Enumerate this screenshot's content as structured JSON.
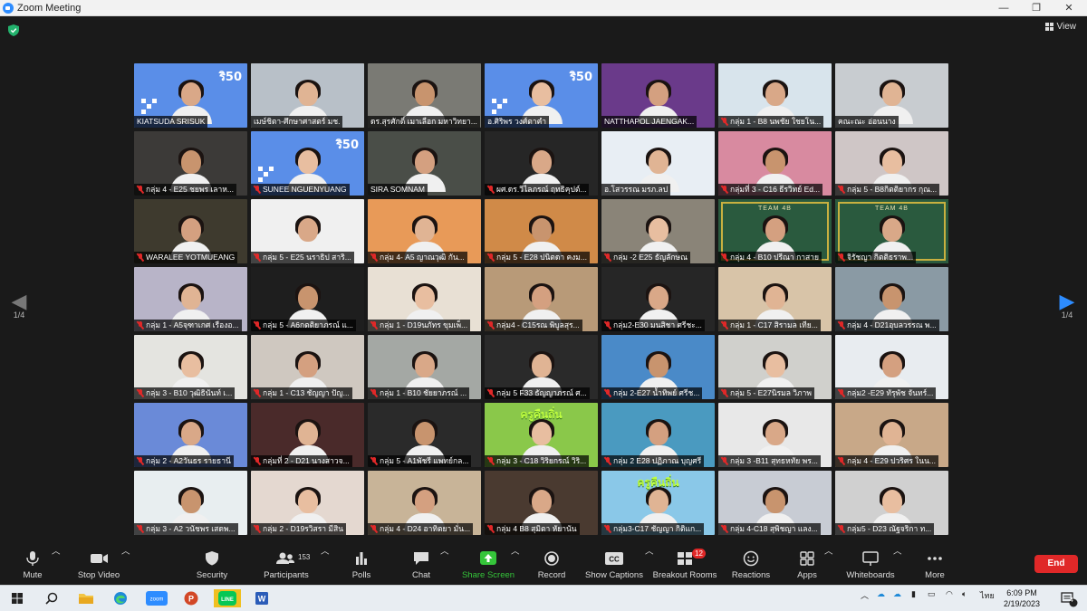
{
  "window": {
    "title": "Zoom Meeting",
    "minimize": "—",
    "maximize": "❐",
    "close": "✕"
  },
  "view_button": "View",
  "pager": {
    "left": "1/4",
    "right": "1/4"
  },
  "participants": [
    {
      "name": "KIATSUDA SRISUK",
      "muted": false,
      "bg": "#5a8ee8",
      "brand": "ริ50"
    },
    {
      "name": "เมษ์ชิตา-ศึกษาศาสตร์ มช.",
      "muted": false,
      "bg": "#b8c0c8",
      "active": true
    },
    {
      "name": "ดร.สุรศักดิ์ เมาเลือก มหาวิทยา...",
      "muted": false,
      "bg": "#7a7a74"
    },
    {
      "name": "อ.ศิริพร วงศ์ตาคำ",
      "muted": false,
      "bg": "#5a8ee8",
      "brand": "ริ50"
    },
    {
      "name": "NATTHAPOL JAENGAK...",
      "muted": false,
      "bg": "#6a3a8a"
    },
    {
      "name": "กลุ่ม 1 - B8 นพชัย ใชยโน...",
      "muted": true,
      "bg": "#d8e4ec"
    },
    {
      "name": "คณะณะ อ่อนนาง",
      "muted": false,
      "bg": "#c8ccd0"
    },
    {
      "name": "กลุ่ม 4 - E25 ชยพร เลาห...",
      "muted": true,
      "bg": "#3c3a38"
    },
    {
      "name": "SUNEE NGUENYUANG",
      "muted": true,
      "bg": "#5a8ee8",
      "brand": "ริ50"
    },
    {
      "name": "SIRA SOMNAM",
      "muted": false,
      "bg": "#4a4e48"
    },
    {
      "name": "ผศ.ดร.วิไลภรณ์ ฤทธิคุปต์...",
      "muted": true,
      "bg": "#262626"
    },
    {
      "name": "อ.โสวรรณ มรภ.ลป",
      "muted": false,
      "bg": "#e8eef4"
    },
    {
      "name": "กลุ่มที่ 3 - C16 ธีรวิทย์ Ed...",
      "muted": true,
      "bg": "#d88aa0"
    },
    {
      "name": "กลุ่ม 5 - B8กิตติยากร กุณ...",
      "muted": true,
      "bg": "#cfc6c6"
    },
    {
      "name": "WARALEE YOTMUEANG",
      "muted": true,
      "bg": "#3e3a2e"
    },
    {
      "name": "กลุ่ม 5 - E25 นราธิป สาริ...",
      "muted": true,
      "bg": "#f0f0f0"
    },
    {
      "name": "กลุ่ม 4- A5 ญาณวุฒิ กัน...",
      "muted": true,
      "bg": "#e89a58"
    },
    {
      "name": "กลุ่ม 5 - E28 ปนิตดา คงม...",
      "muted": true,
      "bg": "#d08a48"
    },
    {
      "name": "กลุ่ม -2 E25 ธัญลักษณ",
      "muted": true,
      "bg": "#8a8478"
    },
    {
      "name": "กลุ่ม 4 - B10 ปรีณา กาสาย",
      "muted": true,
      "bg": "#2a5a3e",
      "board": "TEAM 4B",
      "active": true
    },
    {
      "name": "จิรัชญา กิตติธราพ...",
      "muted": true,
      "bg": "#2a5a3e",
      "board": "TEAM 4B",
      "active": true
    },
    {
      "name": "กลุ่ม 1 - A5จุฑาเกศ เรืองอ...",
      "muted": true,
      "bg": "#b8b4c8"
    },
    {
      "name": "กลุ่ม 5 - A6กตติยาภรณ์ แ...",
      "muted": true,
      "bg": "#1e1e1e"
    },
    {
      "name": "กลุ่ม 1 - D19นภัทร ขุมเพ็...",
      "muted": true,
      "bg": "#e8e0d4"
    },
    {
      "name": "กลุ่ม4 - C15รณ พิบูลสุร...",
      "muted": true,
      "bg": "#b89a78"
    },
    {
      "name": "กลุ่ม2-E30 มนสิชา ศรีชะ...",
      "muted": true,
      "bg": "#262626"
    },
    {
      "name": "กลุ่ม 1 - C17 สิรามล เทีย...",
      "muted": true,
      "bg": "#d8c4a8"
    },
    {
      "name": "กลุ่ม 4 - D21อุบลวรรณ พ...",
      "muted": true,
      "bg": "#8a9aa4"
    },
    {
      "name": "กลุ่ม 3 - B10 วุฒิธินันท์ เ...",
      "muted": true,
      "bg": "#e4e4e0"
    },
    {
      "name": "กลุ่ม 1 - C13 ชัญญา ปัญ...",
      "muted": true,
      "bg": "#cfc8c0"
    },
    {
      "name": "กลุ่ม 1 - B10 ชัยยาภรณ์ ...",
      "muted": true,
      "bg": "#a4a8a4"
    },
    {
      "name": "กลุ่ม 5 F33 ธัญญาภรณ์ ศ...",
      "muted": true,
      "bg": "#2a2a2a"
    },
    {
      "name": "กลุ่ม 2-E27 น้ำทิพย์ ศรีช...",
      "muted": true,
      "bg": "#4a8ac8"
    },
    {
      "name": "กลุ่ม 5 - E27นิรมล วิภาพ",
      "muted": true,
      "bg": "#d0d0cc"
    },
    {
      "name": "กลุ่ม2 -E29 ทัรุพัช จันทร์...",
      "muted": true,
      "bg": "#e8ecf0"
    },
    {
      "name": "กลุ่ม 2 - A2วันธร รายธานี",
      "muted": true,
      "bg": "#6a8ad8"
    },
    {
      "name": "กลุ่มที่ 2 - D21 นางสาวจ...",
      "muted": true,
      "bg": "#4a2a2a"
    },
    {
      "name": "กลุ่ม 5 - A1พัชรี แพทย์กล...",
      "muted": true,
      "bg": "#2a2a2a"
    },
    {
      "name": "กลุ่ม 3 - C18 วิริยกรณ์ วิริ...",
      "muted": true,
      "bg": "#8ac84a",
      "poster": "ครูคืนถิ่น"
    },
    {
      "name": "กลุ่ม 2 E28 ปฏิภาณ บุญศรี",
      "muted": true,
      "bg": "#4a9ac0"
    },
    {
      "name": "กลุ่ม 3 -B11 สุทธหทัย พร...",
      "muted": true,
      "bg": "#e8e8e8"
    },
    {
      "name": "กลุ่ม 4 - E29 ปวริศร ในน...",
      "muted": true,
      "bg": "#c8a888"
    },
    {
      "name": "กลุ่ม 3 - A2 วนัชพร เสดพ...",
      "muted": true,
      "bg": "#e8eef0"
    },
    {
      "name": "กลุ่ม 2 - D19รวิสรา มีสิน",
      "muted": true,
      "bg": "#e4d8d0"
    },
    {
      "name": "กลุ่ม 4 - D24 อาทิตยา มั่น...",
      "muted": true,
      "bg": "#c8b498"
    },
    {
      "name": "กลุ่ม 4 B8 สุมิตา หัยานัน",
      "muted": true,
      "bg": "#4a3a30"
    },
    {
      "name": "กลุ่ม3-C17 ชัญญา กิติแก...",
      "muted": true,
      "bg": "#8ac8e8",
      "poster": "ครูคืนถิ่น"
    },
    {
      "name": "กลุ่ม 4-C18 สุพิชญา แลง...",
      "muted": true,
      "bg": "#c8ccd4"
    },
    {
      "name": "กลุ่ม5 - D23 ณัฐจริกา ท...",
      "muted": true,
      "bg": "#d0d0d0"
    }
  ],
  "toolbar": {
    "mute": "Mute",
    "stop_video": "Stop Video",
    "security": "Security",
    "participants": "Participants",
    "participants_count": "153",
    "polls": "Polls",
    "chat": "Chat",
    "share_screen": "Share Screen",
    "record": "Record",
    "show_captions": "Show Captions",
    "breakout_rooms": "Breakout Rooms",
    "breakout_badge": "12",
    "reactions": "Reactions",
    "apps": "Apps",
    "whiteboards": "Whiteboards",
    "more": "More",
    "end": "End",
    "share_color": "#35c53a",
    "end_color": "#e02828"
  },
  "taskbar": {
    "lang": "ไทย",
    "time": "6:09 PM",
    "date": "2/19/2023",
    "notif": "4"
  }
}
